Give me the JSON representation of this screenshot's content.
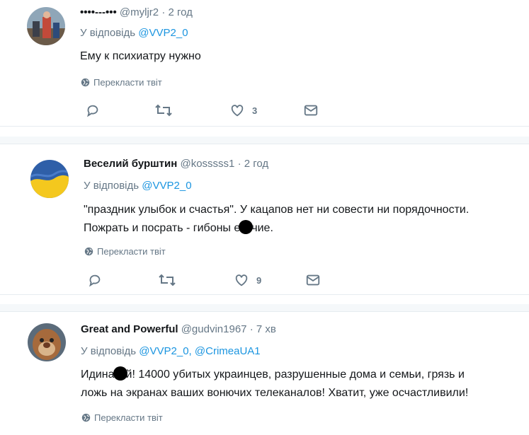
{
  "tweets": [
    {
      "name": "••••---•••",
      "handle": "@myljr2",
      "time": "· 2 год",
      "reply_prefix": "У відповідь",
      "reply_to": "@VVP2_0",
      "text": "Ему к психиатру нужно",
      "translate": "Перекласти твіт",
      "likes": "3"
    },
    {
      "name": "Веселий бурштин",
      "handle": "@kosssss1",
      "time": "· 2 год",
      "reply_prefix": "У відповідь",
      "reply_to": "@VVP2_0",
      "text_line1": "\"праздник улыбок и счастья\". У кацапов нет ни совести ни порядочности.",
      "text_line2_a": "Пожрать и посрать - гибоны е",
      "text_line2_b": "чие.",
      "translate": "Перекласти твіт",
      "likes": "9"
    },
    {
      "name": "Great and Powerful",
      "handle": "@gudvin1967",
      "time": "· 7 хв",
      "reply_prefix": "У відповідь",
      "reply_to": "@VVP2_0",
      "reply_sep": ",",
      "reply_to_2": "@CrimeaUA1",
      "text_line1_a": "Идина",
      "text_line1_b": "й! 14000 убитых украинцев, разрушенные дома и семьи, грязь и",
      "text_line2": "ложь на экранах ваших вонючих телеканалов! Хватит, уже осчастливили!",
      "translate": "Перекласти твіт"
    }
  ],
  "colors": {
    "link": "#1b95e0",
    "muted": "#657786",
    "text": "#14171a",
    "divider": "#e6ecf0"
  }
}
